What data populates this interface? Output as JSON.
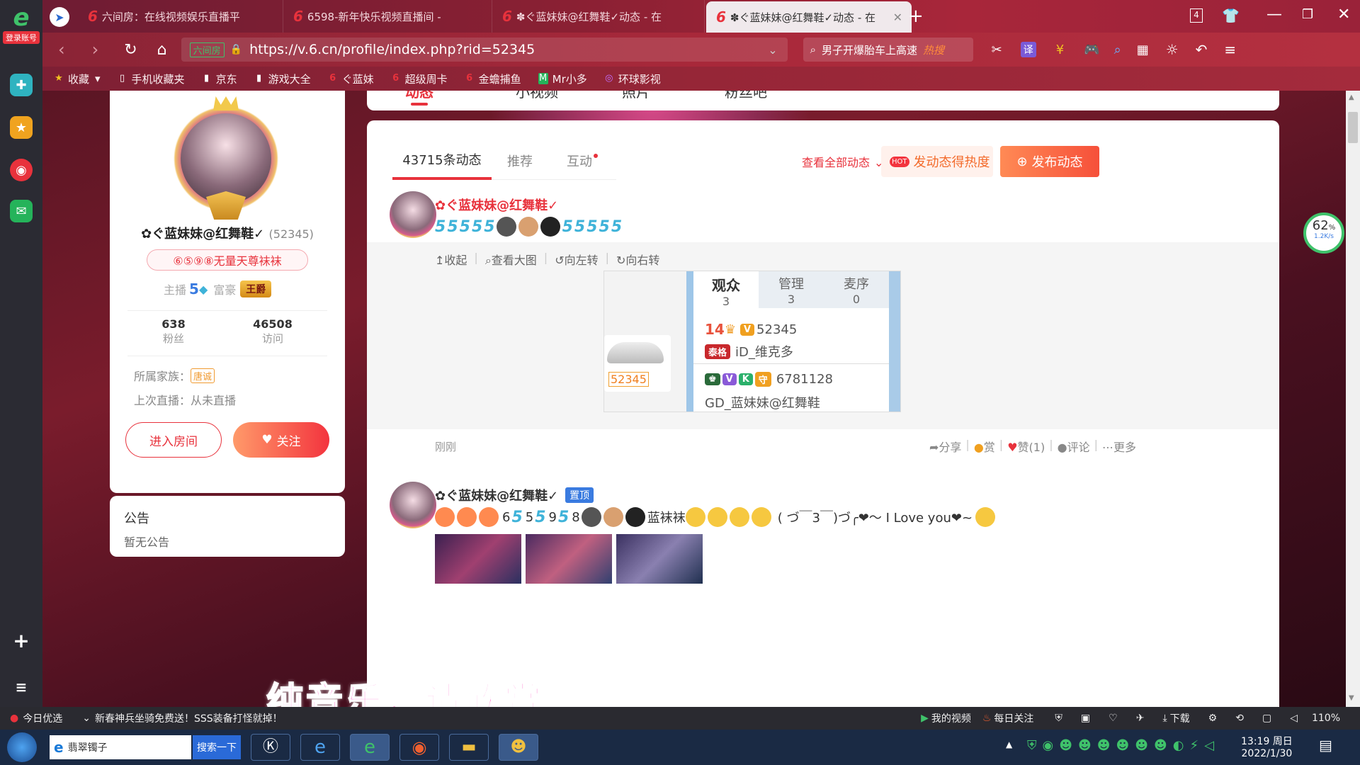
{
  "browser": {
    "tabs": [
      {
        "label": "六间房：在线视频娱乐直播平"
      },
      {
        "label": "6598-新年快乐视频直播间 -"
      },
      {
        "label": "✽ぐ蓝妹妹@红舞鞋✓动态 - 在"
      },
      {
        "label": "✽ぐ蓝妹妹@红舞鞋✓动态 - 在"
      }
    ],
    "tab_count": "4",
    "login_label": "登录账号",
    "site_tag": "六间房",
    "url": "https://v.6.cn/profile/index.php?rid=52345",
    "search_text": "男子开爆胎车上高速",
    "hot_tag": "热搜",
    "translate": "译",
    "bookmarks": [
      "收藏",
      "手机收藏夹",
      "京东",
      "游戏大全",
      "ぐ蓝妹",
      "超级周卡",
      "金蟾捕鱼",
      "Mr小多",
      "环球影视"
    ]
  },
  "profile": {
    "name": "✿ぐ蓝妹妹@红舞鞋✓",
    "rid": "(52345)",
    "title": "⑥⑤⑨⑧无量天尊袜袜",
    "anchor_label": "主播",
    "anchor_level": "5",
    "rich_label": "富豪",
    "rich_badge": "王爵",
    "fans_count": "638",
    "fans_label": "粉丝",
    "visit_count": "46508",
    "visit_label": "访问",
    "family_label": "所属家族：",
    "family": "唐诚",
    "last_live": "上次直播：从未直播",
    "enter_room": "进入房间",
    "follow": "关注",
    "notice_title": "公告",
    "notice_text": "暂无公告"
  },
  "top_tabs": [
    "动态",
    "小视频",
    "照片",
    "粉丝吧"
  ],
  "feed": {
    "tabs": [
      "43715条动态",
      "推荐",
      "互动"
    ],
    "view_all": "查看全部动态",
    "hot_btn": "发动态得热度",
    "hot_tag": "HOT",
    "publish_btn": "发布动态",
    "image_tools": [
      "收起",
      "查看大图",
      "向左转",
      "向右转"
    ],
    "post1": {
      "name": "✿ぐ蓝妹妹@红舞鞋✓",
      "time": "刚刚",
      "actions": [
        "分享",
        "赏",
        "赞(1)",
        "评论",
        "更多"
      ]
    },
    "screenshot": {
      "tabs": [
        {
          "label": "观众",
          "count": "3"
        },
        {
          "label": "管理",
          "count": "3"
        },
        {
          "label": "麦序",
          "count": "0"
        }
      ],
      "user1_level": "14",
      "user1_v": "V",
      "user1_id": "52345",
      "user1_badge": "泰格",
      "user1_name": "iD_维克多",
      "user2_id": "6781128",
      "user2_name": "GD_蓝妹妹@红舞鞋",
      "car_id": "52345"
    },
    "post2": {
      "name": "✿ぐ蓝妹妹@红舞鞋✓",
      "pin": "置顶",
      "text_tail": "蓝袜袜",
      "text_end": "( づ￣3￣)づ╭❤～ I Love you❤~"
    }
  },
  "overlay_caption": "纯音乐，请欣赏",
  "status": {
    "left": "今日优选",
    "news": "新春神兵坐骑免费送！SSS装备打怪就掉！",
    "my_video": "我的视频",
    "daily": "每日关注",
    "download": "下载",
    "zoom": "110%"
  },
  "taskbar": {
    "search_placeholder": "翡翠镯子",
    "search_btn": "搜索一下",
    "time": "13:19 周日",
    "date": "2022/1/30"
  },
  "speed": {
    "percent": "62",
    "unit": "%",
    "rate": "1.2K/s"
  },
  "colors": {
    "brand_red": "#e8323c",
    "orange": "#ff7a45"
  }
}
